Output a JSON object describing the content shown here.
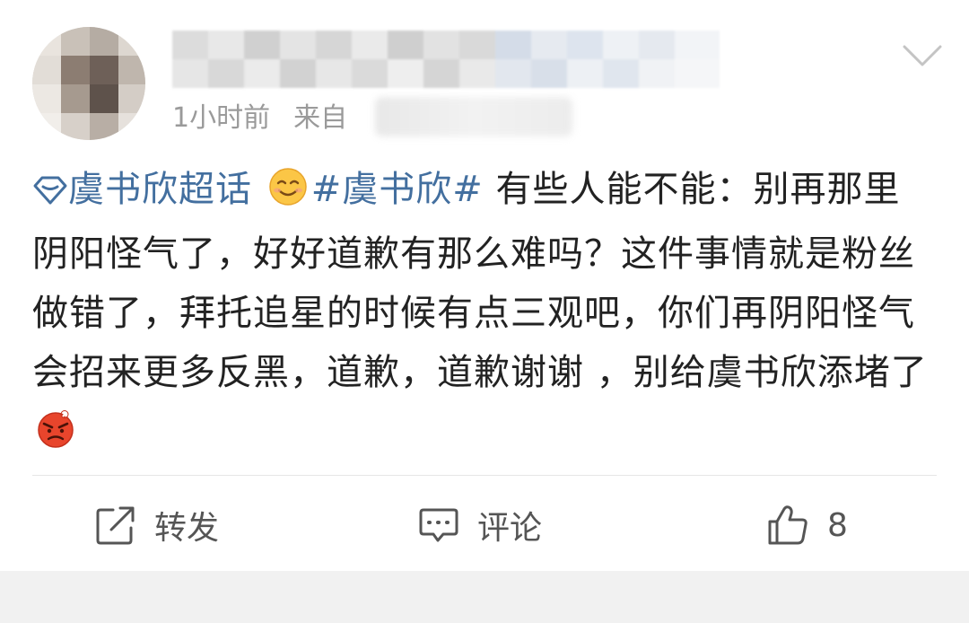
{
  "post": {
    "time": "1小时前",
    "source_prefix": "来自",
    "content": {
      "topic_link": "虞书欣超话",
      "hashtag": "#虞书欣#",
      "text": "有些人能不能：别再那里阴阳怪气了，好好道歉有那么难吗？这件事情就是粉丝做错了，拜托追星的时候有点三观吧，你们再阴阳怪气会招来更多反黑，道歉，道歉谢谢 ，别给虞书欣添堵了"
    },
    "icons": {
      "menu": "chevron-down-icon",
      "topic": "super-topic-diamond-icon",
      "emoji_1": "smile-emoji-icon",
      "emoji_2": "angry-emoji-icon",
      "repost": "repost-icon",
      "comment": "comment-icon",
      "like": "thumbs-up-icon"
    },
    "actions": {
      "repost_label": "转发",
      "comment_label": "评论",
      "like_count": "8"
    },
    "colors": {
      "link": "#436f9f",
      "text": "#222222",
      "meta": "#9a9a9a",
      "action": "#555555",
      "background": "#ffffff",
      "separator_bg": "#f1f1f1"
    }
  }
}
